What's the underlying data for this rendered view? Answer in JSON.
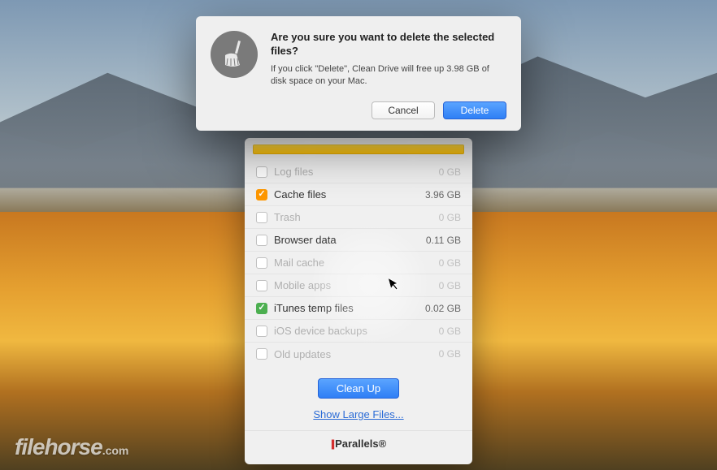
{
  "watermark": "filehorse",
  "watermark_suffix": ".com",
  "main": {
    "items": [
      {
        "label": "Log files",
        "size": "0 GB",
        "checked": false,
        "dimmed": true,
        "color": ""
      },
      {
        "label": "Cache files",
        "size": "3.96 GB",
        "checked": true,
        "dimmed": false,
        "color": "orange"
      },
      {
        "label": "Trash",
        "size": "0 GB",
        "checked": false,
        "dimmed": true,
        "color": ""
      },
      {
        "label": "Browser data",
        "size": "0.11 GB",
        "checked": false,
        "dimmed": false,
        "color": ""
      },
      {
        "label": "Mail cache",
        "size": "0 GB",
        "checked": false,
        "dimmed": true,
        "color": ""
      },
      {
        "label": "Mobile apps",
        "size": "0 GB",
        "checked": false,
        "dimmed": true,
        "color": ""
      },
      {
        "label": "iTunes temp files",
        "size": "0.02 GB",
        "checked": true,
        "dimmed": false,
        "color": "green"
      },
      {
        "label": "iOS device backups",
        "size": "0 GB",
        "checked": false,
        "dimmed": true,
        "color": ""
      },
      {
        "label": "Old updates",
        "size": "0 GB",
        "checked": false,
        "dimmed": true,
        "color": ""
      }
    ],
    "cleanup_label": "Clean Up",
    "large_files_link": "Show Large Files...",
    "brand": "Parallels"
  },
  "dialog": {
    "title": "Are you sure you want to delete the selected files?",
    "message": "If you click \"Delete\", Clean Drive will free up 3.98 GB of disk space on your Mac.",
    "cancel_label": "Cancel",
    "confirm_label": "Delete",
    "icon": "broom-icon"
  }
}
